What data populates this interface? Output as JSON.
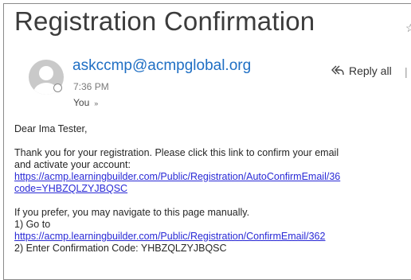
{
  "email": {
    "subject": "Registration Confirmation",
    "subject_tail": "☆",
    "sender": "askccmp@acmpglobal.org",
    "time": "7:36 PM",
    "recipients": "You",
    "recipients_chevron": "»",
    "reply_all_label": "Reply all",
    "reply_sep": "|",
    "body": {
      "greeting": "Dear Ima Tester,",
      "para1_line1": "Thank you for your registration.  Please click this link to confirm your email",
      "para1_line2": "and activate your account:",
      "confirm_link_line1": "https://acmp.learningbuilder.com/Public/Registration/AutoConfirmEmail/36",
      "confirm_link_line2": "code=YHBZQLZYJBQSC",
      "manual_intro": "If you prefer, you may navigate to this page manually.",
      "step1": "1) Go to",
      "manual_link": "https://acmp.learningbuilder.com/Public/Registration/ConfirmEmail/362",
      "step2": "2) Enter Confirmation Code: YHBZQLZYJBQSC"
    }
  },
  "icons": {
    "avatar": "person-avatar",
    "presence": "presence-status-icon",
    "reply_all": "reply-all-icon"
  }
}
